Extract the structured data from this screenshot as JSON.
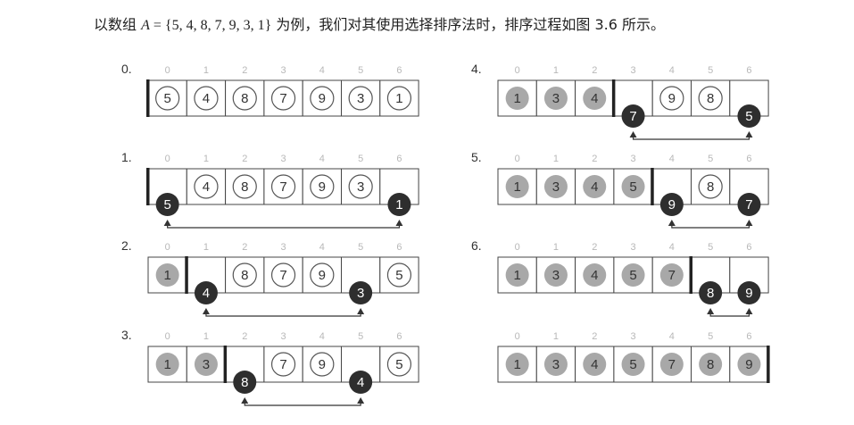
{
  "caption": {
    "prefix": "以数组 ",
    "var": "A",
    "set": " = {5, 4, 8, 7, 9, 3, 1}",
    "suffix": " 为例，我们对其使用选择排序法时，排序过程如图 3.6 所示。"
  },
  "index_labels": [
    "0",
    "1",
    "2",
    "3",
    "4",
    "5",
    "6"
  ],
  "colors": {
    "sorted_fill": "#a8a8a8",
    "selected_fill": "#2e2e2e",
    "unsorted_stroke": "#555555",
    "cell_border": "#444444",
    "boundary_bar": "#222222",
    "arrow": "#333333"
  },
  "steps": [
    {
      "label": "0.",
      "values": [
        5,
        4,
        8,
        7,
        9,
        3,
        1
      ],
      "states": [
        "u",
        "u",
        "u",
        "u",
        "u",
        "u",
        "u"
      ],
      "boundary": 0,
      "swap": null
    },
    {
      "label": "1.",
      "values": [
        5,
        4,
        8,
        7,
        9,
        3,
        1
      ],
      "states": [
        "x",
        "u",
        "u",
        "u",
        "u",
        "u",
        "x"
      ],
      "boundary": 0,
      "swap": [
        0,
        6
      ]
    },
    {
      "label": "2.",
      "values": [
        1,
        4,
        8,
        7,
        9,
        3,
        5
      ],
      "states": [
        "s",
        "x",
        "u",
        "u",
        "u",
        "x",
        "u"
      ],
      "boundary": 1,
      "swap": [
        1,
        5
      ]
    },
    {
      "label": "3.",
      "values": [
        1,
        3,
        8,
        7,
        9,
        4,
        5
      ],
      "states": [
        "s",
        "s",
        "x",
        "u",
        "u",
        "x",
        "u"
      ],
      "boundary": 2,
      "swap": [
        2,
        5
      ]
    },
    {
      "label": "4.",
      "values": [
        1,
        3,
        4,
        7,
        9,
        8,
        5
      ],
      "states": [
        "s",
        "s",
        "s",
        "x",
        "u",
        "u",
        "x"
      ],
      "boundary": 3,
      "swap": [
        3,
        6
      ]
    },
    {
      "label": "5.",
      "values": [
        1,
        3,
        4,
        5,
        9,
        8,
        7
      ],
      "states": [
        "s",
        "s",
        "s",
        "s",
        "x",
        "u",
        "x"
      ],
      "boundary": 4,
      "swap": [
        4,
        6
      ]
    },
    {
      "label": "6.",
      "values": [
        1,
        3,
        4,
        5,
        7,
        8,
        9
      ],
      "states": [
        "s",
        "s",
        "s",
        "s",
        "s",
        "x",
        "x"
      ],
      "boundary": 5,
      "swap": [
        5,
        6
      ]
    },
    {
      "label": "",
      "values": [
        1,
        3,
        4,
        5,
        7,
        8,
        9
      ],
      "states": [
        "s",
        "s",
        "s",
        "s",
        "s",
        "s",
        "s"
      ],
      "boundary": 7,
      "swap": null
    }
  ]
}
